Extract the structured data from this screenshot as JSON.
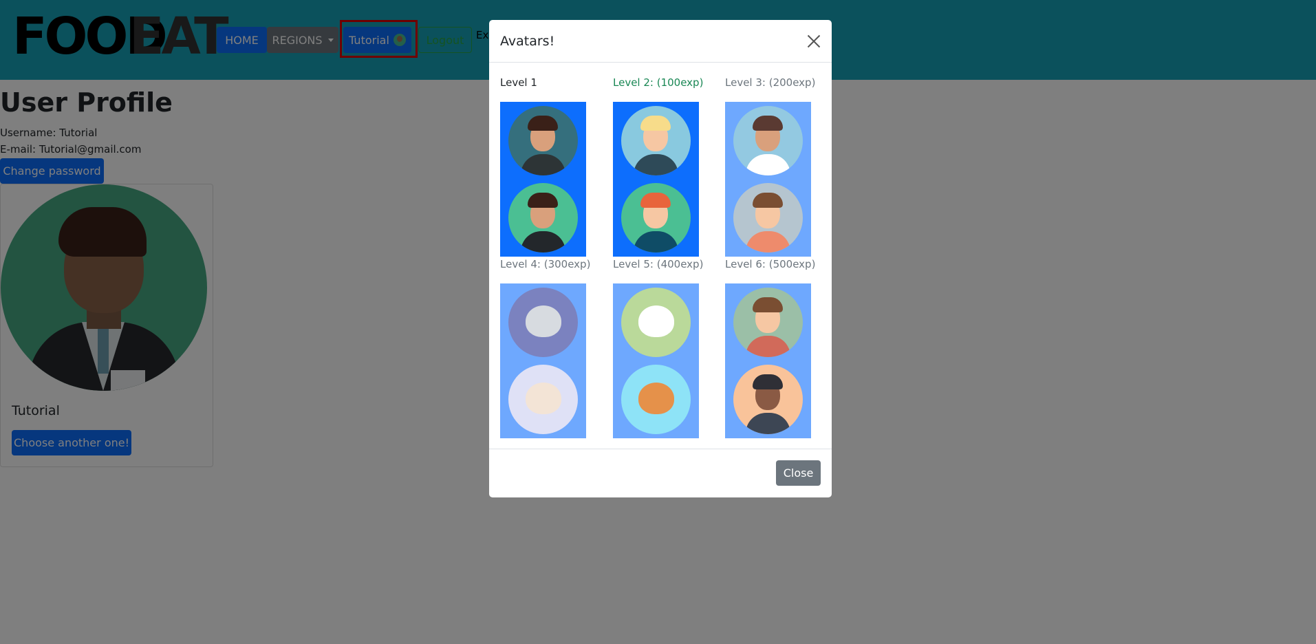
{
  "navbar": {
    "logo_primary": "FOOD",
    "logo_secondary": "EAT",
    "home_label": "HOME",
    "regions_label": "REGIONS",
    "user_label": "Tutorial",
    "logout_label": "Logout",
    "exp_label": "Exp",
    "bg_color": "#17a2b8"
  },
  "profile": {
    "title": "User Profile",
    "username_line": "Username: Tutorial",
    "email_line": "E-mail: Tutorial@gmail.com",
    "change_password_label": "Change password",
    "card_name": "Tutorial",
    "choose_label": "Choose another one!"
  },
  "modal": {
    "title": "Avatars!",
    "levels": [
      "Level 1",
      "Level 2: (100exp)",
      "Level 3: (200exp)",
      "Level 4: (300exp)",
      "Level 5: (400exp)",
      "Level 6: (500exp)"
    ],
    "close_label": "Close",
    "avatars": [
      {
        "name": "woman-avatar-1",
        "bg": "#356f7d",
        "level": 1
      },
      {
        "name": "blonde-woman-avatar",
        "bg": "#89c9df",
        "level": 2
      },
      {
        "name": "long-hair-woman-avatar",
        "bg": "#93c9e1",
        "level": 3
      },
      {
        "name": "businessman-avatar",
        "bg": "#4bbf93",
        "level": 1
      },
      {
        "name": "redhead-man-avatar",
        "bg": "#4bbf93",
        "level": 2
      },
      {
        "name": "blond-man-avatar",
        "bg": "#b5c5cf",
        "level": 3
      },
      {
        "name": "cat-avatar",
        "bg": "#7b82bf",
        "level": 4
      },
      {
        "name": "panda-avatar",
        "bg": "#bad99a",
        "level": 5
      },
      {
        "name": "glasses-man-avatar",
        "bg": "#9bbfa7",
        "level": 6
      },
      {
        "name": "dog-avatar",
        "bg": "#dfe1f6",
        "level": 4
      },
      {
        "name": "fox-avatar",
        "bg": "#8ee3f7",
        "level": 5
      },
      {
        "name": "woman-curly-avatar",
        "bg": "#f9c39a",
        "level": 6
      }
    ]
  }
}
